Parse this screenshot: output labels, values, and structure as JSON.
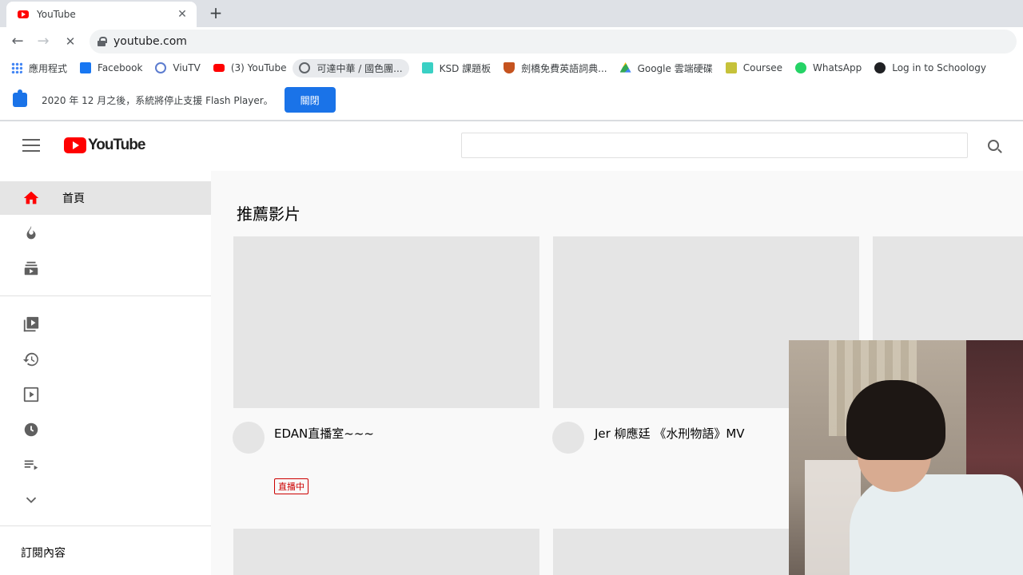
{
  "browser": {
    "tab": {
      "title": "YouTube",
      "close": "✕"
    },
    "new_tab": "+",
    "nav": {
      "back": "←",
      "forward": "→",
      "reload": "✕"
    },
    "url": "youtube.com"
  },
  "bookmarks": [
    {
      "label": "應用程式",
      "color": "#4285f4",
      "icon": "apps-grid-icon"
    },
    {
      "label": "Facebook",
      "color": "#1877f2",
      "icon": "facebook-icon"
    },
    {
      "label": "ViuTV",
      "color": "#5c7ccf",
      "icon": "viutv-icon"
    },
    {
      "label": "(3) YouTube",
      "color": "#ff0000",
      "icon": "youtube-icon"
    },
    {
      "label": "可達中華 / 國色團...",
      "color": "#5f6368",
      "icon": "globe-icon"
    },
    {
      "label": "KSD 課題板",
      "color": "#3ad0c4",
      "icon": "ksd-icon"
    },
    {
      "label": "劍橋免費英語詞典...",
      "color": "#c5531f",
      "icon": "shield-icon"
    },
    {
      "label": "Google 雲端硬碟",
      "color": "#34a853",
      "icon": "google-drive-icon"
    },
    {
      "label": "Coursee",
      "color": "#c6c23a",
      "icon": "coursee-icon"
    },
    {
      "label": "WhatsApp",
      "color": "#25d366",
      "icon": "whatsapp-icon"
    },
    {
      "label": "Log in to Schoology",
      "color": "#202124",
      "icon": "schoology-icon"
    }
  ],
  "infobar": {
    "text": "2020 年 12 月之後，系統將停止支援 Flash Player。",
    "button": "關閉"
  },
  "youtube": {
    "logo_text": "YouTube",
    "search_placeholder": "",
    "sidebar": {
      "home_label": "首頁",
      "subscriptions_heading": "訂閱內容"
    },
    "section_title": "推薦影片",
    "videos": [
      {
        "title": "EDAN直播室~~~",
        "badge": "直播中"
      },
      {
        "title": "Jer 柳應廷 《水刑物語》MV",
        "badge": ""
      }
    ]
  }
}
